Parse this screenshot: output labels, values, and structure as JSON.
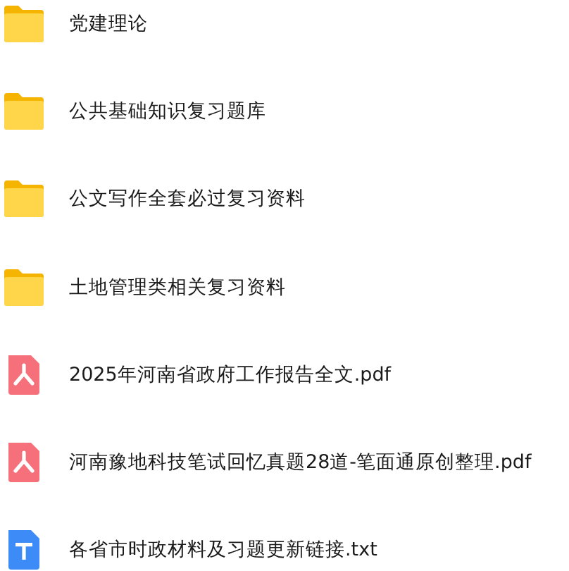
{
  "files": [
    {
      "kind": "folder",
      "name": "党建理论"
    },
    {
      "kind": "folder",
      "name": "公共基础知识复习题库"
    },
    {
      "kind": "folder",
      "name": "公文写作全套必过复习资料"
    },
    {
      "kind": "folder",
      "name": "土地管理类相关复习资料"
    },
    {
      "kind": "pdf",
      "name": "2025年河南省政府工作报告全文.pdf"
    },
    {
      "kind": "pdf",
      "name": "河南豫地科技笔试回忆真题28道-笔面通原创整理.pdf"
    },
    {
      "kind": "txt",
      "name": "各省市时政材料及习题更新链接.txt"
    }
  ]
}
